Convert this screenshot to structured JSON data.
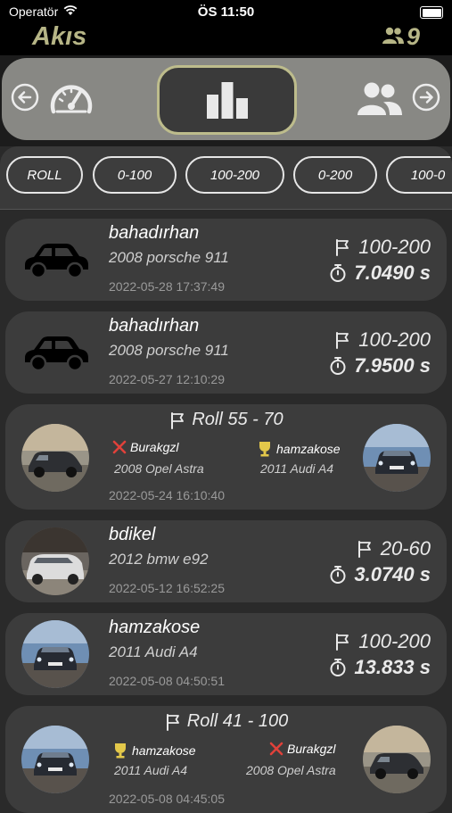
{
  "status": {
    "carrier": "Operatör",
    "time": "ÖS 11:50"
  },
  "nav": {
    "title": "Akıs",
    "follower_count": "9"
  },
  "filters": [
    "ROLL",
    "0-100",
    "100-200",
    "0-200",
    "100-0"
  ],
  "feed": [
    {
      "type": "single",
      "user": "bahadırhan",
      "car": "2008 porsche 911",
      "date": "2022-05-28 17:37:49",
      "range": "100-200",
      "time": "7.0490 s"
    },
    {
      "type": "single",
      "user": "bahadırhan",
      "car": "2008 porsche 911",
      "date": "2022-05-27 12:10:29",
      "range": "100-200",
      "time": "7.9500 s"
    },
    {
      "type": "roll",
      "title": "Roll  55 - 70",
      "left_user": "Burakgzl",
      "left_car": "2008 Opel Astra",
      "left_result": "lose",
      "right_user": "hamzakose",
      "right_car": "2011 Audi A4",
      "right_result": "win",
      "date": "2022-05-24 16:10:40"
    },
    {
      "type": "single",
      "user": "bdikel",
      "car": "2012 bmw e92",
      "date": "2022-05-12 16:52:25",
      "range": "20-60",
      "time": "3.0740 s"
    },
    {
      "type": "single",
      "user": "hamzakose",
      "car": "2011 Audi A4",
      "date": "2022-05-08 04:50:51",
      "range": "100-200",
      "time": "13.833 s"
    },
    {
      "type": "roll",
      "title": "Roll  41 - 100",
      "left_user": "hamzakose",
      "left_car": "2011 Audi A4",
      "left_result": "win",
      "right_user": "Burakgzl",
      "right_car": "2008 Opel Astra",
      "right_result": "lose",
      "date": "2022-05-08 04:45:05"
    }
  ],
  "colors": {
    "accent": "#b6b586",
    "win": "#e3c84a",
    "lose": "#e0413a"
  }
}
